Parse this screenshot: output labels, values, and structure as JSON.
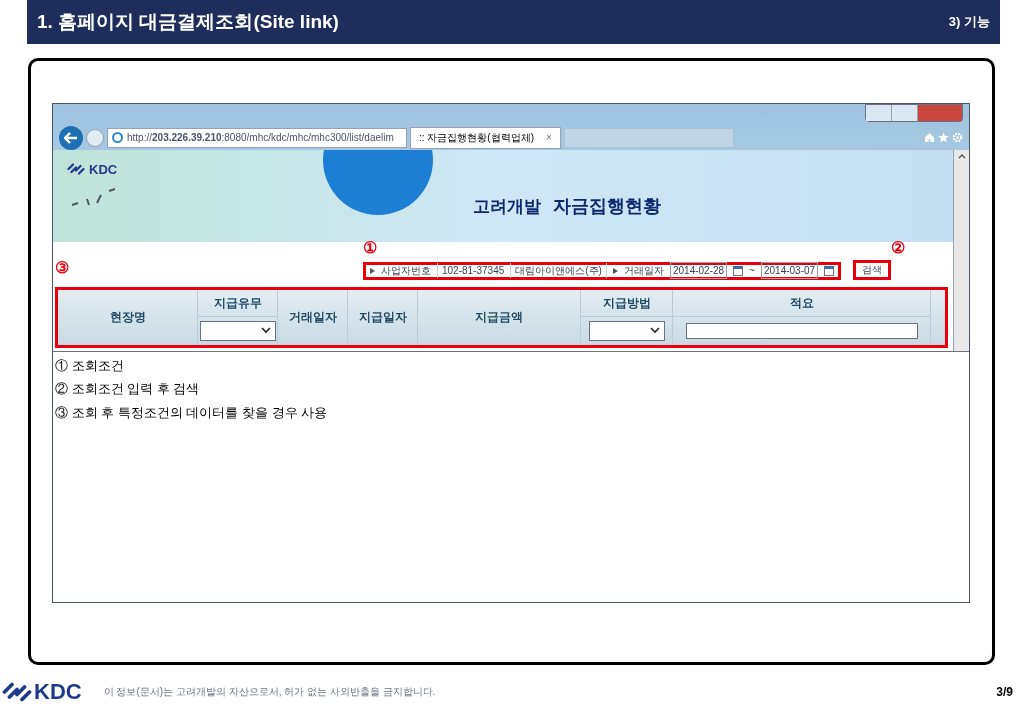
{
  "header": {
    "title": "1. 홈페이지 대금결제조회(Site link)",
    "section": "3) 기능"
  },
  "browser": {
    "url": "http://**203.226.39.210**:8080/mhc/kdc/mhc/mhc300/list/daelim",
    "tabs": [
      {
        "label": ":: 자금집행현황(협력업체)",
        "close": "×",
        "selected": true
      },
      {
        "selected": false
      }
    ]
  },
  "site": {
    "logo": "KDC",
    "brand": "고려개발",
    "title": "자금집행현황"
  },
  "search": {
    "callout": "①",
    "biz_label": "사업자번호",
    "biz_no": "102-81-37345",
    "company": "대림아이앤에스(주)",
    "date_label": "거래일자",
    "date_from": "2014-02-28",
    "tilde": "~",
    "date_to": "2014-03-07",
    "button_callout": "②",
    "button": "검색"
  },
  "table": {
    "callout": "③",
    "columns": [
      {
        "label": "현장명",
        "kind": "plain"
      },
      {
        "label": "지급유무",
        "kind": "select"
      },
      {
        "label": "거래일자",
        "kind": "plain"
      },
      {
        "label": "지급일자",
        "kind": "plain"
      },
      {
        "label": "지급금액",
        "kind": "plain"
      },
      {
        "label": "지급방법",
        "kind": "select"
      },
      {
        "label": "적요",
        "kind": "input"
      }
    ]
  },
  "notes": [
    "① 조회조건",
    "② 조회조건 입력 후 검색",
    "③ 조회 후 특정조건의 데이터를 찾을 경우 사용"
  ],
  "footer": {
    "logo": "KDC",
    "notice": "이 정보(문서)는 고려개발의 자산으로서, 허가 없는 사외반출을 금지합니다.",
    "page": "3/9"
  }
}
